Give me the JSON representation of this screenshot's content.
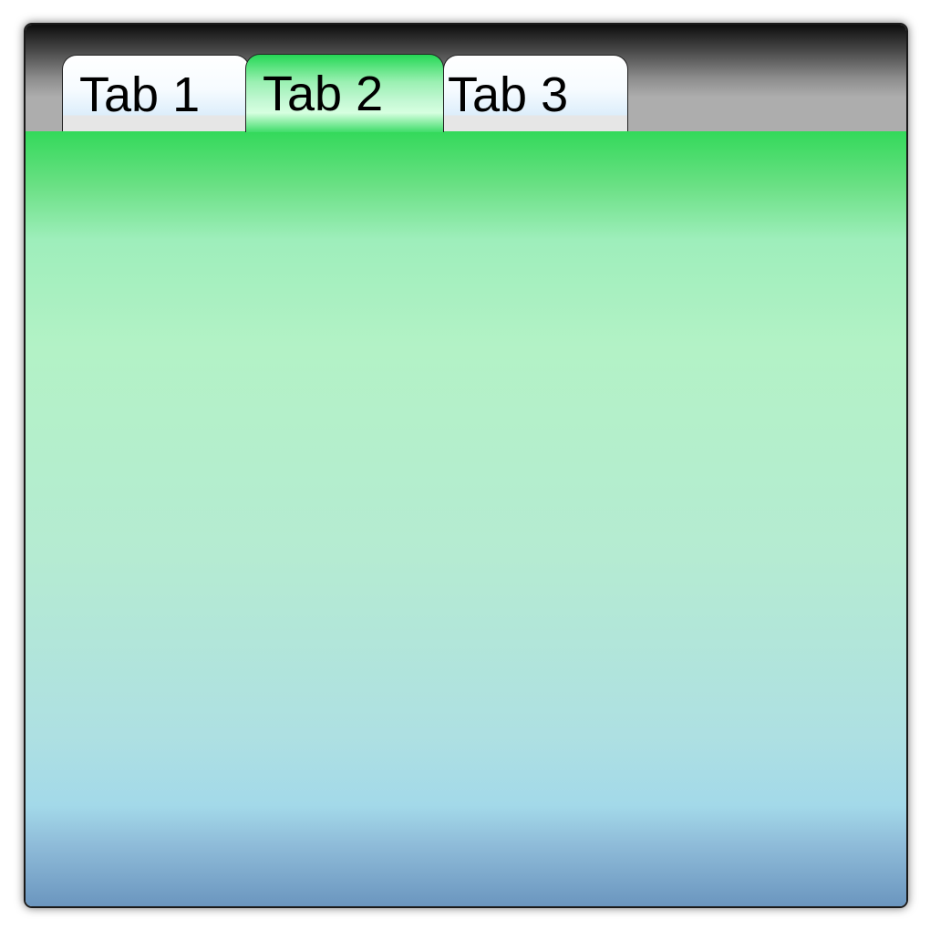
{
  "tabs": [
    {
      "label": "Tab 1",
      "active": false
    },
    {
      "label": "Tab 2",
      "active": true
    },
    {
      "label": "Tab 3",
      "active": false
    }
  ],
  "colors": {
    "active_tab": "#25d855",
    "tabbar_dark": "#0d0d0d",
    "tabbar_light": "#adadad",
    "content_top": "#33d95a",
    "content_bottom": "#6b96bf"
  }
}
